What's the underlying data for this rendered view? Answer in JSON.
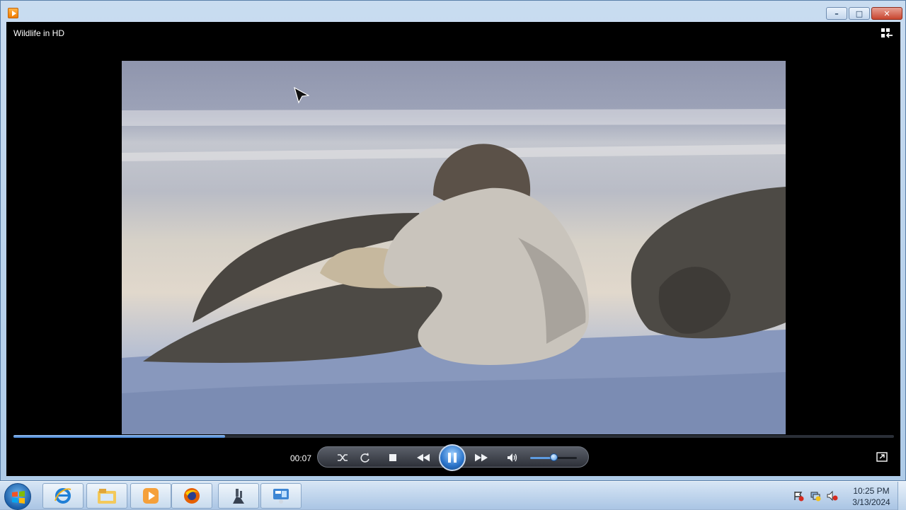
{
  "window": {
    "controls": {
      "minimize": "–",
      "maximize": "□",
      "close": "✕"
    }
  },
  "player": {
    "video_title": "Wildlife in HD",
    "current_time": "00:07",
    "progress": 0.24,
    "volume": 0.5,
    "icons": [
      "switch-to-library-icon",
      "shuffle-icon",
      "repeat-icon",
      "stop-icon",
      "previous-icon",
      "pause-icon",
      "next-icon",
      "volume-icon",
      "fullscreen-icon"
    ]
  },
  "taskbar": {
    "pinned": [
      "internet-explorer-icon",
      "windows-explorer-icon",
      "windows-media-player-icon",
      "firefox-icon",
      "app-icon",
      "network-app-icon"
    ],
    "clock": {
      "time": "10:25 PM",
      "date": "3/13/2024"
    },
    "tray_icons": [
      "action-center-icon",
      "network-icon",
      "volume-muted-icon"
    ]
  }
}
